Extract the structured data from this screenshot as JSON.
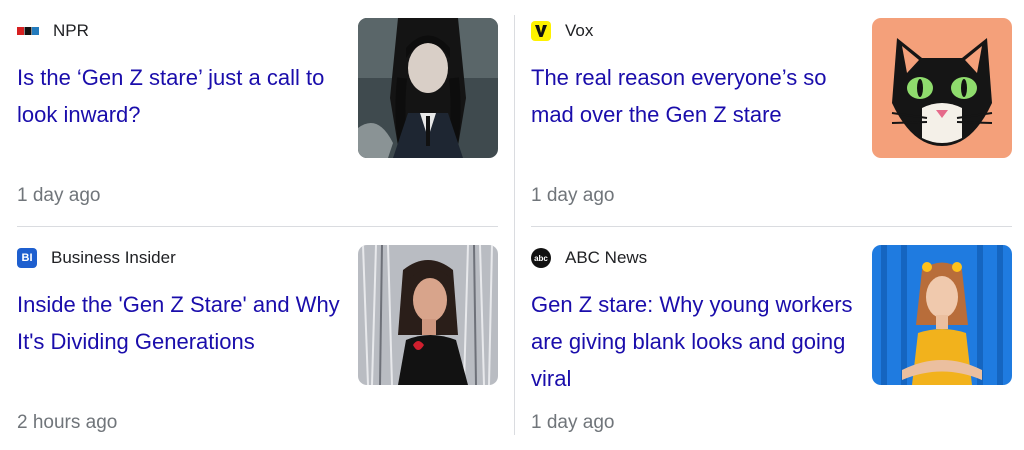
{
  "articles": [
    {
      "source": "NPR",
      "headline": "Is the ‘Gen Z stare’ just a call to look inward?",
      "time": "1 day ago",
      "logo_icon": "npr-logo-icon",
      "thumbnail": "dark-haired-woman-braids-photo"
    },
    {
      "source": "Vox",
      "headline": "The real reason everyone’s so mad over the Gen Z stare",
      "time": "1 day ago",
      "logo_icon": "vox-logo-icon",
      "thumbnail": "cat-illustration"
    },
    {
      "source": "Business Insider",
      "headline": "Inside the 'Gen Z Stare' and Why It's Dividing Generations",
      "time": "2 hours ago",
      "logo_icon": "business-insider-logo-icon",
      "logo_text": "BI",
      "thumbnail": "woman-tinsel-background-photo"
    },
    {
      "source": "ABC News",
      "headline": "Gen Z stare: Why young workers are giving blank looks and going viral",
      "time": "1 day ago",
      "logo_icon": "abc-news-logo-icon",
      "logo_text": "abc",
      "thumbnail": "woman-blue-curtain-photo"
    }
  ],
  "colors": {
    "headline": "#1a0dab",
    "time": "#70757a",
    "divider": "#dadce0"
  }
}
